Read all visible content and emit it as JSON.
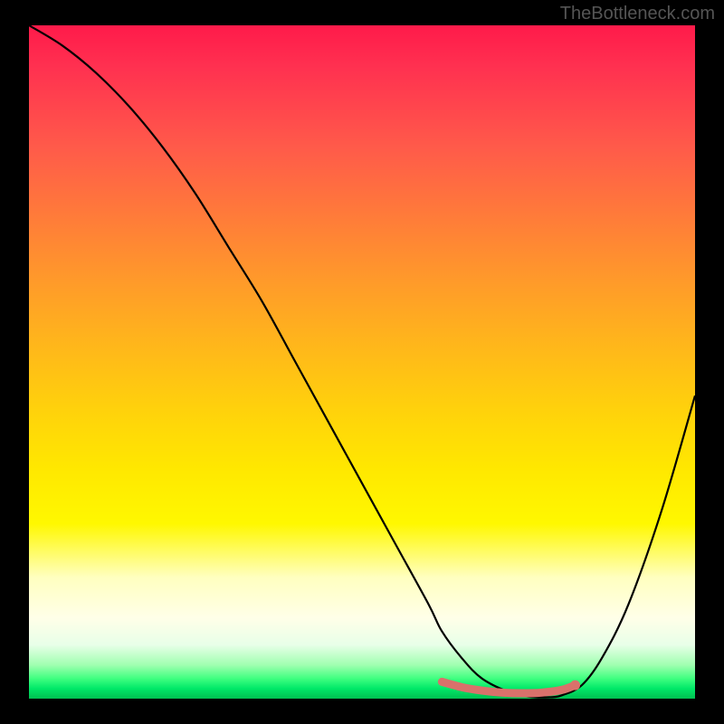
{
  "watermark": "TheBottleneck.com",
  "chart_data": {
    "type": "line",
    "title": "",
    "xlabel": "",
    "ylabel": "",
    "xlim": [
      0,
      100
    ],
    "ylim": [
      0,
      100
    ],
    "grid": false,
    "series": [
      {
        "name": "bottleneck-curve",
        "x": [
          0,
          5,
          10,
          15,
          20,
          25,
          30,
          35,
          40,
          45,
          50,
          55,
          60,
          62,
          65,
          68,
          72,
          75,
          78,
          80,
          83,
          86,
          90,
          95,
          100
        ],
        "y": [
          100,
          97,
          93,
          88,
          82,
          75,
          67,
          59,
          50,
          41,
          32,
          23,
          14,
          10,
          6,
          3,
          1,
          0.3,
          0.2,
          0.5,
          2,
          6,
          14,
          28,
          45
        ]
      }
    ],
    "highlight": {
      "name": "optimal-zone",
      "x": [
        62,
        65,
        68,
        71,
        74,
        77,
        80,
        82
      ],
      "y": [
        2.5,
        1.7,
        1.2,
        0.9,
        0.8,
        0.9,
        1.3,
        2.0
      ]
    },
    "background_gradient": {
      "top_color": "#ff1a4a",
      "mid_color": "#ffe800",
      "bottom_color": "#00c050"
    }
  }
}
